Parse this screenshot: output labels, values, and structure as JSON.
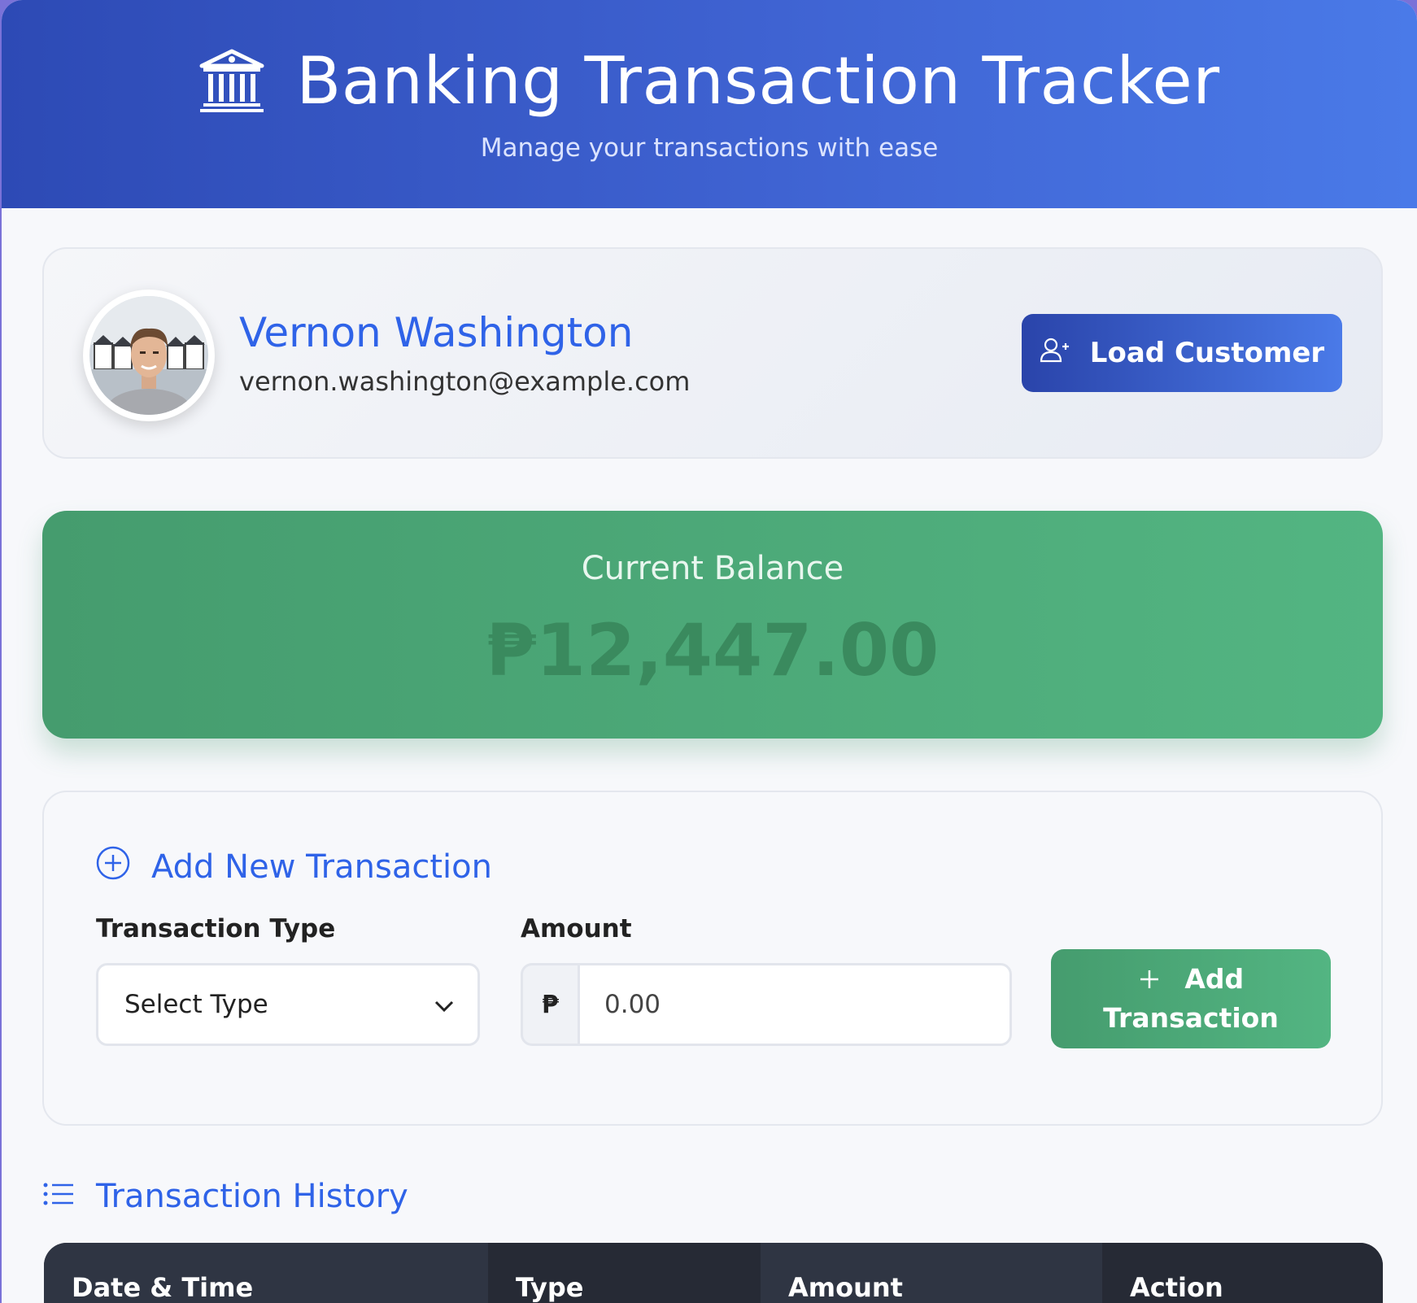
{
  "header": {
    "title": "Banking Transaction Tracker",
    "subtitle": "Manage your transactions with ease",
    "icon": "bank-icon"
  },
  "customer": {
    "name": "Vernon Washington",
    "email": "vernon.washington@example.com",
    "load_button": "Load Customer"
  },
  "balance": {
    "label": "Current Balance",
    "amount": "₱12,447.00"
  },
  "form": {
    "title": "Add New Transaction",
    "type_label": "Transaction Type",
    "type_selected": "Select Type",
    "amount_label": "Amount",
    "currency_symbol": "₱",
    "amount_placeholder": "0.00",
    "add_button_line1": "Add",
    "add_button_line2": "Transaction"
  },
  "history": {
    "title": "Transaction History",
    "columns": [
      "Date & Time",
      "Type",
      "Amount",
      "Action"
    ]
  },
  "colors": {
    "accent": "#2f63e8",
    "success": "#4fa97a",
    "header_dark": "#2d4ab5"
  }
}
